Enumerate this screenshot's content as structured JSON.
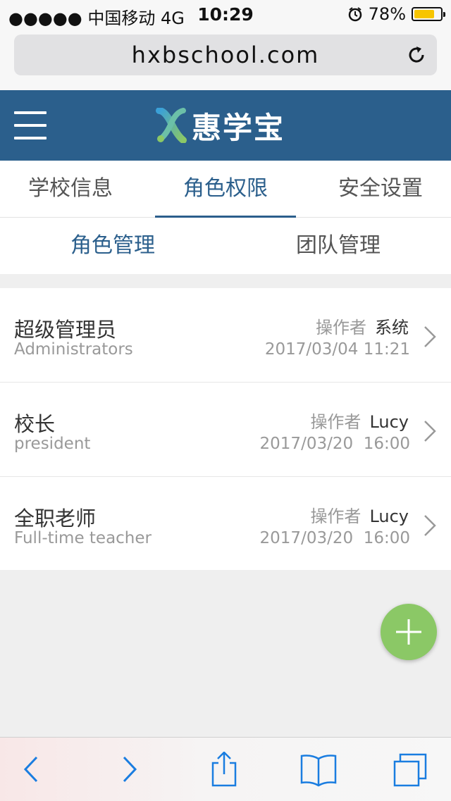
{
  "status_bar": {
    "carrier": "●●●●● 中国移动  4G",
    "time": "10:29",
    "battery_text": "78%",
    "battery_level": 0.78
  },
  "browser": {
    "url": "hxbschool.com"
  },
  "header": {
    "logo_text": "惠学宝"
  },
  "tabs": [
    {
      "label": "学校信息",
      "active": false
    },
    {
      "label": "角色权限",
      "active": true
    },
    {
      "label": "安全设置",
      "active": false
    }
  ],
  "subtabs": [
    {
      "label": "角色管理",
      "active": true
    },
    {
      "label": "团队管理",
      "active": false
    }
  ],
  "roles": [
    {
      "title": "超级管理员",
      "subtitle": "Administrators",
      "operator_label": "操作者",
      "operator": "系统",
      "date": "2017/03/04 11:21"
    },
    {
      "title": "校长",
      "subtitle": "president",
      "operator_label": "操作者",
      "operator": "Lucy",
      "date": "2017/03/20  16:00"
    },
    {
      "title": "全职老师",
      "subtitle": "Full-time teacher",
      "operator_label": "操作者",
      "operator": "Lucy",
      "date": "2017/03/20  16:00"
    }
  ],
  "colors": {
    "brand": "#2b5f8c",
    "fab": "#8bc866",
    "ios_blue": "#1a7de0"
  }
}
